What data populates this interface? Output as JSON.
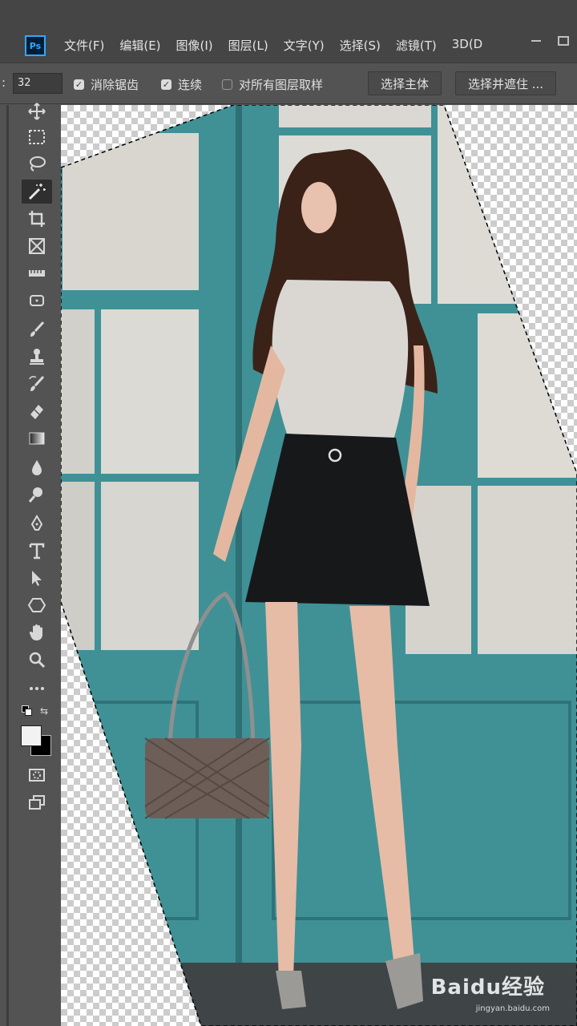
{
  "app": {
    "logo_text": "Ps"
  },
  "menu": [
    "文件(F)",
    "编辑(E)",
    "图像(I)",
    "图层(L)",
    "文字(Y)",
    "选择(S)",
    "滤镜(T)",
    "3D(D"
  ],
  "options": {
    "colon": ":",
    "tolerance": "32",
    "antialias_label": "消除锯齿",
    "contiguous_label": "连续",
    "sample_all_label": "对所有图层取样",
    "select_subject_label": "选择主体",
    "select_mask_label": "选择并遮住 ..."
  },
  "toolbar": {
    "active_tool": "magic-wand",
    "tools": [
      "move",
      "marquee",
      "lasso",
      "magic-wand",
      "crop",
      "frame",
      "eyedropper",
      "patch",
      "brush",
      "clone-stamp",
      "history-brush",
      "eraser",
      "gradient",
      "blur",
      "dodge",
      "pen",
      "type",
      "path-selection",
      "shape",
      "hand",
      "zoom",
      "more"
    ],
    "foreground_color": "#f2f2f2",
    "background_color": "#000000"
  },
  "watermark": {
    "brand": "Baidu经验",
    "url": "jingyan.baidu.com"
  },
  "colors": {
    "door_teal": "#3f9196",
    "ui_panel": "#535353",
    "menubar": "#454545"
  }
}
